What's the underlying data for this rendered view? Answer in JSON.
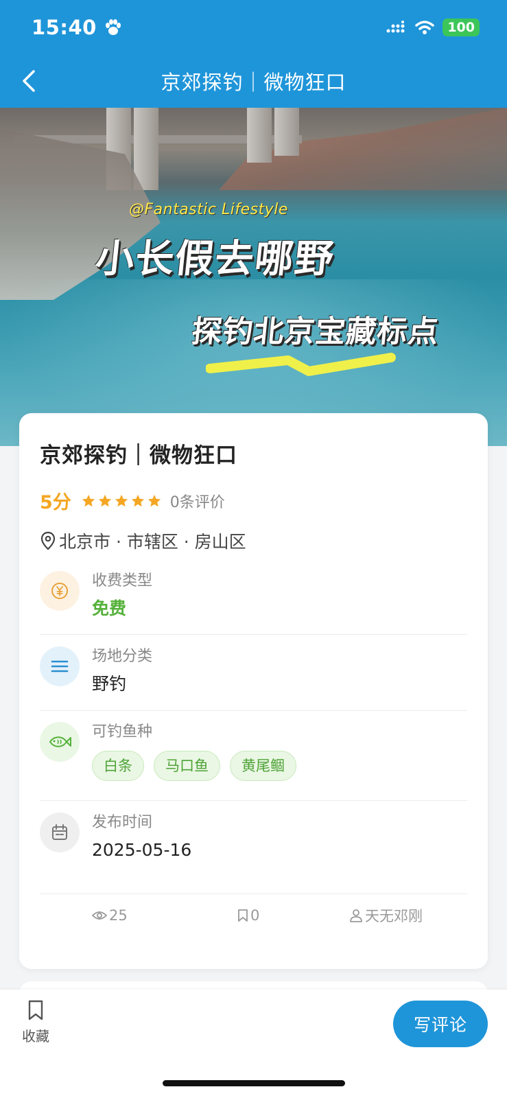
{
  "status_bar": {
    "time": "15:40",
    "battery": "100"
  },
  "nav": {
    "title": "京郊探钓｜微物狂口"
  },
  "hero": {
    "watermark": "@Fantastic Lifestyle",
    "headline": "小长假去哪野",
    "subheadline": "探钓北京宝藏标点"
  },
  "spot": {
    "title": "京郊探钓｜微物狂口",
    "score": "5分",
    "stars": 5,
    "review_count": "0条评价",
    "location": "北京市 · 市辖区 · 房山区"
  },
  "info": {
    "fee": {
      "label": "收费类型",
      "value": "免费"
    },
    "category": {
      "label": "场地分类",
      "value": "野钓"
    },
    "fish": {
      "label": "可钓鱼种",
      "items": [
        "白条",
        "马口鱼",
        "黄尾鲴"
      ]
    },
    "publish": {
      "label": "发布时间",
      "value": "2025-05-16"
    }
  },
  "stats": {
    "views": "25",
    "favorites": "0",
    "author": "天无邓刚"
  },
  "bottom": {
    "favorite_label": "收藏",
    "review_button": "写评论"
  },
  "colors": {
    "primary": "#1f95d9",
    "score": "#f5a623",
    "green": "#55b13a"
  }
}
